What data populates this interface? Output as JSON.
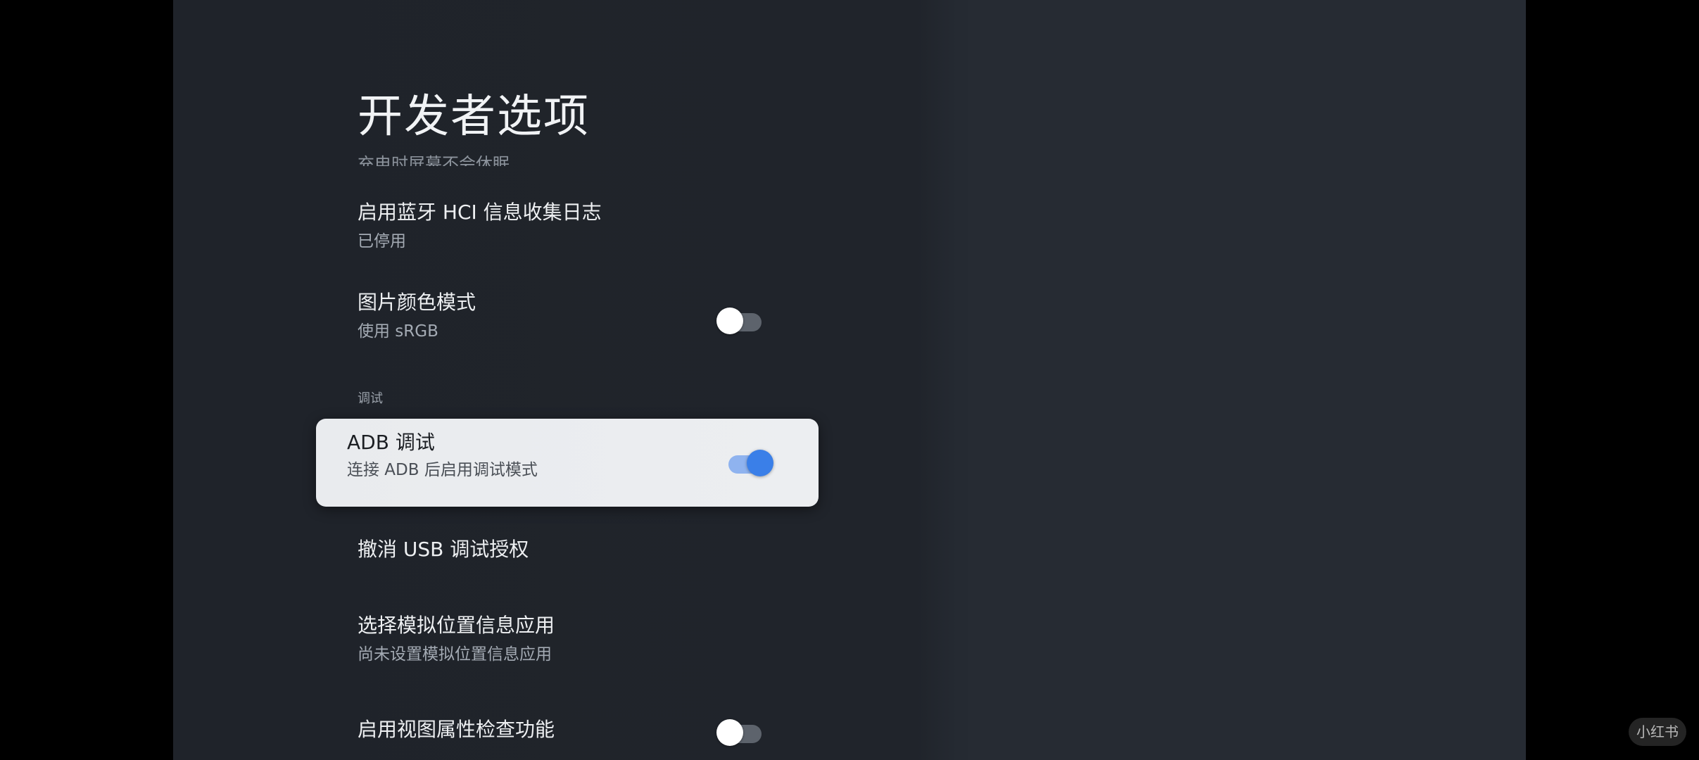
{
  "page": {
    "title": "开发者选项"
  },
  "cutoff_item": {
    "text": "充电时屏幕不会休眠"
  },
  "items": [
    {
      "title": "启用蓝牙 HCI 信息收集日志",
      "subtitle": "已停用"
    },
    {
      "title": "图片颜色模式",
      "subtitle": "使用 sRGB",
      "toggle": "off"
    }
  ],
  "section": {
    "label": "调试"
  },
  "focused_item": {
    "title": "ADB 调试",
    "subtitle": "连接 ADB 后启用调试模式",
    "toggle": "on"
  },
  "items_after": [
    {
      "title": "撤消 USB 调试授权"
    },
    {
      "title": "选择模拟位置信息应用",
      "subtitle": "尚未设置模拟位置信息应用"
    },
    {
      "title": "启用视图属性检查功能",
      "toggle": "off"
    }
  ],
  "watermark": {
    "text": "小红书"
  },
  "colors": {
    "accent": "#3a7fe8",
    "accent_track": "#8fb3ef",
    "background": "#20242b",
    "card": "#eceef1"
  }
}
